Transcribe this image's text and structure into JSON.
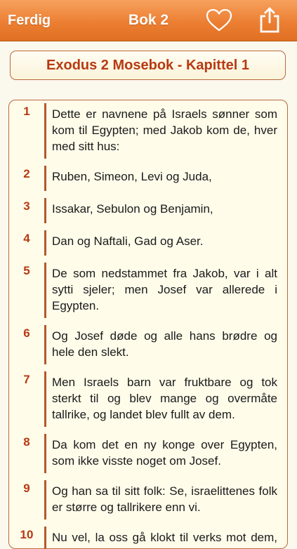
{
  "navbar": {
    "done_label": "Ferdig",
    "title": "Bok 2",
    "favorite_icon": "heart-outline-icon",
    "share_icon": "share-icon",
    "color": "#ec7f33"
  },
  "chapter": {
    "title": "Exodus 2 Mosebok - Kapittel 1",
    "accent_color": "#b73a12"
  },
  "verses": [
    {
      "number": "1",
      "text": "Dette er navnene på Israels sønner som kom til Egypten; med Jakob kom de, hver med sitt hus:"
    },
    {
      "number": "2",
      "text": "Ruben, Simeon, Levi og Juda,"
    },
    {
      "number": "3",
      "text": "Issakar, Sebulon og Benjamin,"
    },
    {
      "number": "4",
      "text": "Dan og Naftali, Gad og Aser."
    },
    {
      "number": "5",
      "text": "De som nedstammet fra Jakob, var i alt sytti sjeler; men Josef var allerede i Egypten."
    },
    {
      "number": "6",
      "text": "Og Josef døde og alle hans brødre og hele den slekt."
    },
    {
      "number": "7",
      "text": "Men Israels barn var fruktbare og tok sterkt til og blev mange og overmåte tallrike, og landet blev fullt av dem."
    },
    {
      "number": "8",
      "text": "Da kom det en ny konge over Egypten, som ikke visste noget om Josef."
    },
    {
      "number": "9",
      "text": "Og han sa til sitt folk: Se, israelittenes folk er større og tallrikere enn vi."
    },
    {
      "number": "10",
      "text": "Nu vel, la oss gå klokt til verks mot dem, forat de ikke skal ta mere til, og"
    }
  ]
}
